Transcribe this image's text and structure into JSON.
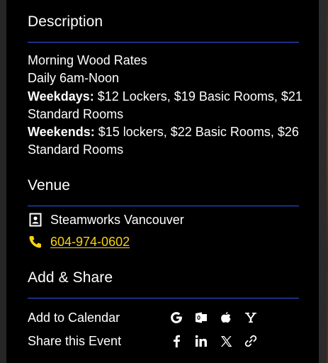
{
  "description": {
    "title": "Description",
    "line1": "Morning Wood Rates",
    "line2": "Daily 6am-Noon",
    "weekdays_label": "Weekdays:",
    "weekdays_text": "$12 Lockers, $19 Basic Rooms, $21 Standard Rooms",
    "weekends_label": "Weekends:",
    "weekends_text": "$15 lockers, $22 Basic Rooms, $26 Standard Rooms"
  },
  "venue": {
    "title": "Venue",
    "name": "Steamworks Vancouver",
    "phone": "604-974-0602"
  },
  "share": {
    "title": "Add & Share",
    "calendar_label": "Add to Calendar",
    "calendar_icons": [
      "google-icon",
      "outlook-icon",
      "apple-icon",
      "yahoo-icon"
    ],
    "share_label": "Share this Event",
    "share_icons": [
      "facebook-icon",
      "linkedin-icon",
      "x-icon",
      "link-icon"
    ]
  },
  "colors": {
    "background": "#000000",
    "rule": "#3355ee",
    "phone_link": "#f5d313",
    "text": "#ffffff"
  }
}
